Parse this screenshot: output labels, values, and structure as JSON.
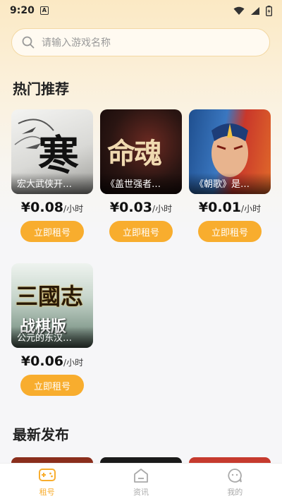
{
  "status_bar": {
    "time": "9:20",
    "notification_badge": "A"
  },
  "search": {
    "placeholder": "请输入游戏名称",
    "icon": "search-icon"
  },
  "sections": {
    "hot": "热门推荐",
    "newest": "最新发布"
  },
  "hot_games": [
    {
      "caption": "宏大武侠开…",
      "art_text": "寒",
      "price": "¥0.08",
      "unit": "/小时",
      "button": "立即租号"
    },
    {
      "caption": "《盖世强者…",
      "art_text": "命魂",
      "price": "¥0.03",
      "unit": "/小时",
      "button": "立即租号"
    },
    {
      "caption": "《朝歌》是…",
      "art_text": "",
      "price": "¥0.01",
      "unit": "/小时",
      "button": "立即租号"
    },
    {
      "caption": "公元的东汉…",
      "art_text": "三國志",
      "art_sub": "战棋版",
      "price": "¥0.06",
      "unit": "/小时",
      "button": "立即租号"
    }
  ],
  "tabbar": [
    {
      "label": "租号",
      "icon": "gamepad-icon",
      "active": true
    },
    {
      "label": "资讯",
      "icon": "home-icon",
      "active": false
    },
    {
      "label": "我的",
      "icon": "chat-face-icon",
      "active": false
    }
  ],
  "colors": {
    "accent": "#f8ad2e",
    "bg": "#f6f6f8"
  }
}
